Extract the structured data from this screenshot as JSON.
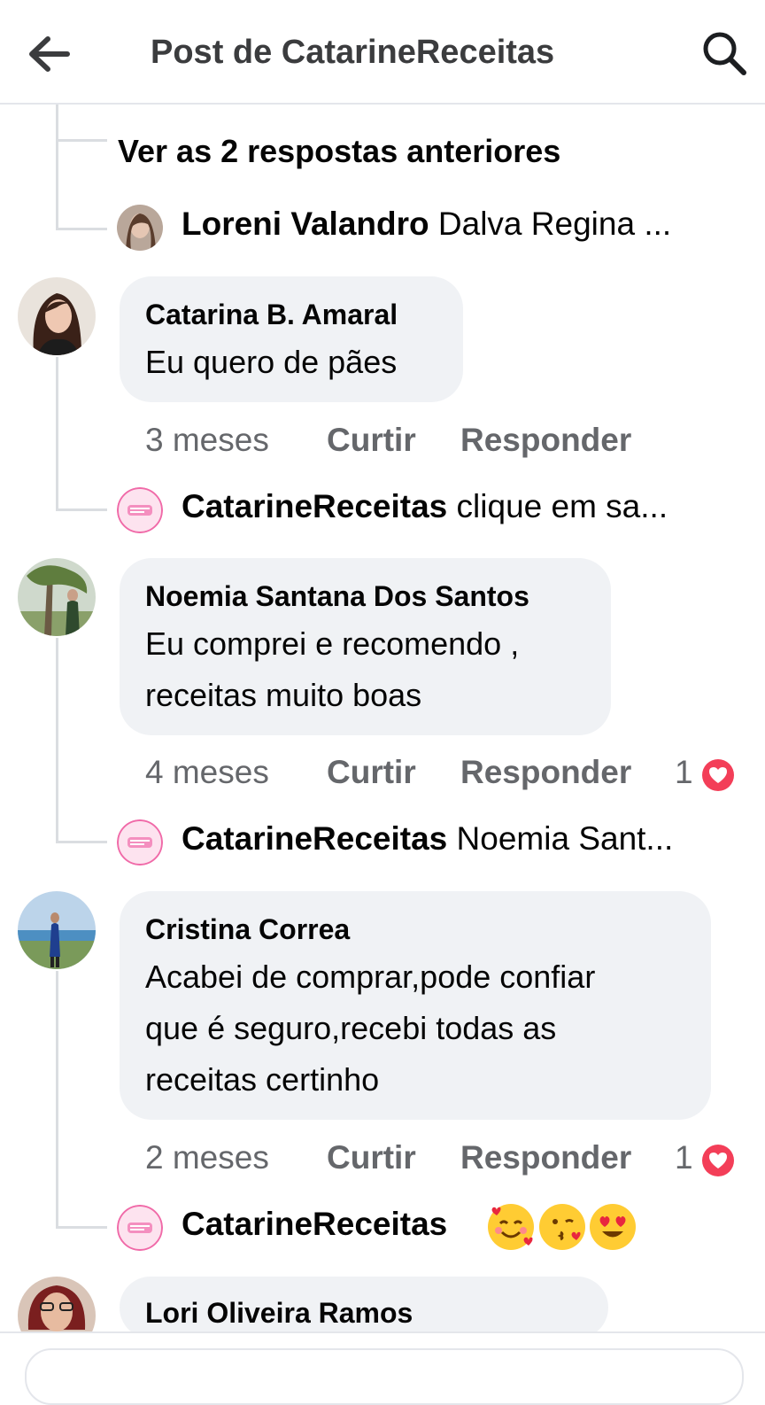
{
  "header": {
    "title": "Post de CatarineReceitas"
  },
  "view_previous": "Ver as 2 respostas anteriores",
  "reply_loreni": {
    "name": "Loreni Valandro",
    "text": "Dalva Regina ..."
  },
  "comments": [
    {
      "name": "Catarina B. Amaral",
      "lines": [
        "Eu quero de pães"
      ],
      "time": "3 meses",
      "like": "Curtir",
      "reply": "Responder",
      "reply_preview": {
        "name": "CatarineReceitas",
        "text": "clique em sa..."
      }
    },
    {
      "name": "Noemia Santana Dos Santos",
      "lines": [
        "Eu comprei e recomendo ,",
        "receitas muito boas"
      ],
      "time": "4 meses",
      "like": "Curtir",
      "reply": "Responder",
      "reactions": "1",
      "reply_preview": {
        "name": "CatarineReceitas",
        "text": "Noemia Sant..."
      }
    },
    {
      "name": "Cristina Correa",
      "lines": [
        "Acabei de comprar,pode confiar",
        "que é seguro,recebi todas as",
        "receitas certinho"
      ],
      "time": "2 meses",
      "like": "Curtir",
      "reply": "Responder",
      "reactions": "1",
      "reply_preview": {
        "name": "CatarineReceitas",
        "text": ""
      }
    },
    {
      "name": "Lori Oliveira Ramos"
    }
  ],
  "emojis": [
    "smiling-face-with-hearts",
    "face-blowing-kiss",
    "heart-eyes"
  ],
  "colors": {
    "bubble": "#f0f2f5",
    "heart": "#f33e58",
    "meta": "#65676b"
  }
}
